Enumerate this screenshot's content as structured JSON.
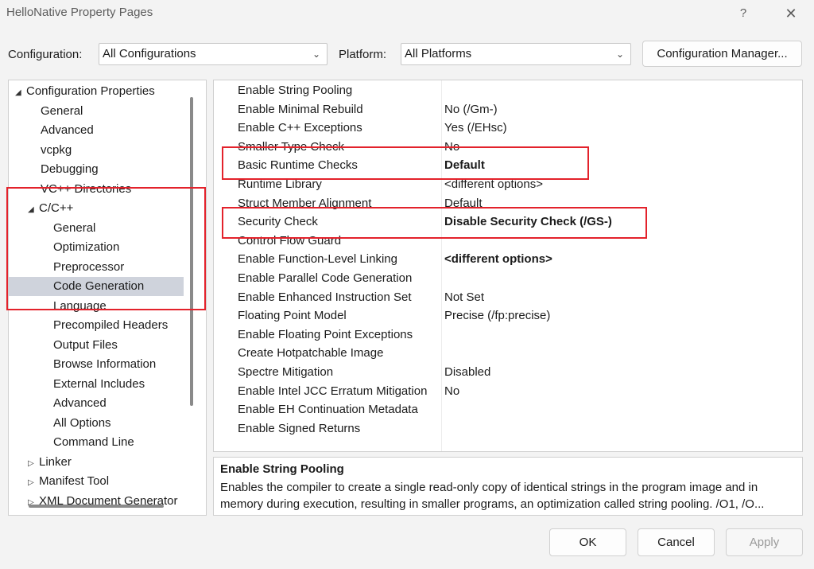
{
  "window": {
    "title": "HelloNative Property Pages",
    "help_glyph": "?",
    "close_glyph": "✕"
  },
  "toolbar": {
    "configuration_label": "Configuration:",
    "configuration_value": "All Configurations",
    "platform_label": "Platform:",
    "platform_value": "All Platforms",
    "config_manager_label": "Configuration Manager..."
  },
  "tree": {
    "items": [
      {
        "label": "Configuration Properties",
        "expander": "◢",
        "level": 0
      },
      {
        "label": "General",
        "level": 1
      },
      {
        "label": "Advanced",
        "level": 1
      },
      {
        "label": "vcpkg",
        "level": 1
      },
      {
        "label": "Debugging",
        "level": 1
      },
      {
        "label": "VC++ Directories",
        "level": 1
      },
      {
        "label": "C/C++",
        "expander": "◢",
        "level": 1
      },
      {
        "label": "General",
        "level": 2
      },
      {
        "label": "Optimization",
        "level": 2
      },
      {
        "label": "Preprocessor",
        "level": 2
      },
      {
        "label": "Code Generation",
        "level": 2,
        "selected": true
      },
      {
        "label": "Language",
        "level": 2
      },
      {
        "label": "Precompiled Headers",
        "level": 2
      },
      {
        "label": "Output Files",
        "level": 2
      },
      {
        "label": "Browse Information",
        "level": 2
      },
      {
        "label": "External Includes",
        "level": 2
      },
      {
        "label": "Advanced",
        "level": 2
      },
      {
        "label": "All Options",
        "level": 2
      },
      {
        "label": "Command Line",
        "level": 2
      },
      {
        "label": "Linker",
        "expander": "▷",
        "level": 1
      },
      {
        "label": "Manifest Tool",
        "expander": "▷",
        "level": 1
      },
      {
        "label": "XML Document Generator",
        "expander": "▷",
        "level": 1
      }
    ]
  },
  "properties": [
    {
      "name": "Enable String Pooling",
      "value": ""
    },
    {
      "name": "Enable Minimal Rebuild",
      "value": "No (/Gm-)"
    },
    {
      "name": "Enable C++ Exceptions",
      "value": "Yes (/EHsc)"
    },
    {
      "name": "Smaller Type Check",
      "value": "No"
    },
    {
      "name": "Basic Runtime Checks",
      "value": "Default",
      "bold": true
    },
    {
      "name": "Runtime Library",
      "value": "<different options>"
    },
    {
      "name": "Struct Member Alignment",
      "value": "Default"
    },
    {
      "name": "Security Check",
      "value": "Disable Security Check (/GS-)",
      "bold": true
    },
    {
      "name": "Control Flow Guard",
      "value": ""
    },
    {
      "name": "Enable Function-Level Linking",
      "value": "<different options>",
      "bold": true
    },
    {
      "name": "Enable Parallel Code Generation",
      "value": ""
    },
    {
      "name": "Enable Enhanced Instruction Set",
      "value": "Not Set"
    },
    {
      "name": "Floating Point Model",
      "value": "Precise (/fp:precise)"
    },
    {
      "name": "Enable Floating Point Exceptions",
      "value": ""
    },
    {
      "name": "Create Hotpatchable Image",
      "value": ""
    },
    {
      "name": "Spectre Mitigation",
      "value": "Disabled"
    },
    {
      "name": "Enable Intel JCC Erratum Mitigation",
      "value": "No"
    },
    {
      "name": "Enable EH Continuation Metadata",
      "value": ""
    },
    {
      "name": "Enable Signed Returns",
      "value": ""
    }
  ],
  "description": {
    "title": "Enable String Pooling",
    "line1": "Enables the compiler to create a single read-only copy of identical strings in the program image and in",
    "line2": "memory during execution, resulting in smaller programs, an optimization called string pooling. /O1, /O..."
  },
  "buttons": {
    "ok": "OK",
    "cancel": "Cancel",
    "apply": "Apply"
  },
  "colors": {
    "highlight_box": "#e3222b",
    "selected_row": "#cfd3dc"
  }
}
